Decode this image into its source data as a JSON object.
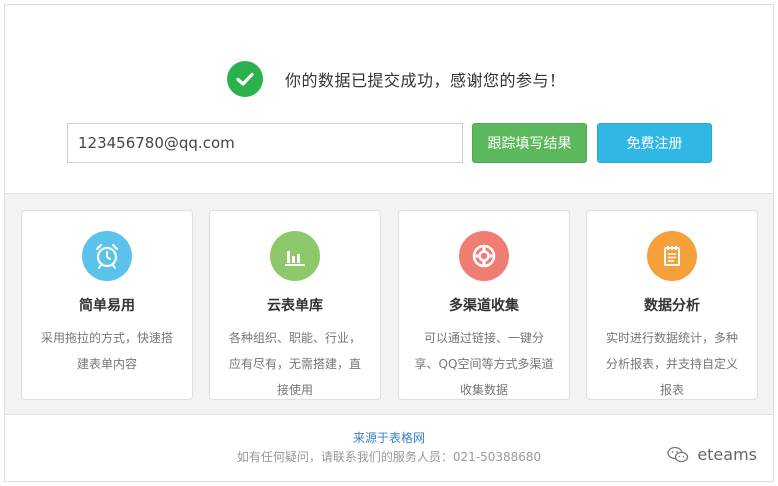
{
  "success": {
    "message": "你的数据已提交成功，感谢您的参与！"
  },
  "form": {
    "email_value": "123456780@qq.com",
    "track_label": "跟踪填写结果",
    "register_label": "免费注册"
  },
  "features": [
    {
      "title": "简单易用",
      "desc": "采用拖拉的方式，快速搭建表单内容",
      "color": "#5bc2ec",
      "icon": "alarm-clock-icon"
    },
    {
      "title": "云表单库",
      "desc": "各种组织、职能、行业，应有尽有，无需搭建，直接使用",
      "color": "#8dc96b",
      "icon": "bar-chart-icon"
    },
    {
      "title": "多渠道收集",
      "desc": "可以通过链接、一键分享、QQ空间等方式多渠道收集数据",
      "color": "#f07d72",
      "icon": "lifebuoy-icon"
    },
    {
      "title": "数据分析",
      "desc": "实时进行数据统计，多种分析报表，并支持自定义报表",
      "color": "#f5a03a",
      "icon": "notepad-icon"
    }
  ],
  "footer": {
    "source": "来源于表格网",
    "contact": "如有任何疑问，请联系我们的服务人员：021-50388680",
    "brand": "eteams"
  },
  "colors": {
    "success_green": "#2ab14b",
    "track_button": "#5cb85c",
    "register_button": "#31b7e6",
    "link_blue": "#3a7fc1"
  }
}
